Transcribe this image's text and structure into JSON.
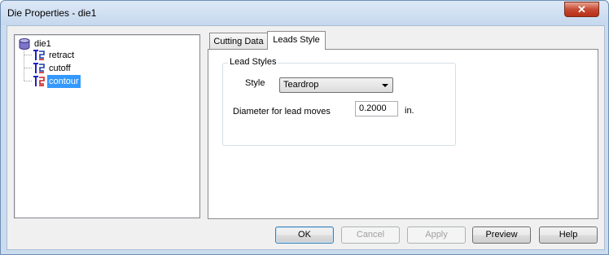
{
  "window": {
    "title": "Die Properties - die1",
    "close_glyph": "✕"
  },
  "tree": {
    "root": {
      "label": "die1",
      "icon": "database-icon"
    },
    "children": [
      {
        "label": "retract",
        "icon": "tool-path-icon",
        "selected": false
      },
      {
        "label": "cutoff",
        "icon": "tool-path-icon",
        "selected": false
      },
      {
        "label": "contour",
        "icon": "tool-path-icon",
        "selected": true
      }
    ]
  },
  "tabs": [
    {
      "label": "Cutting Data",
      "active": false
    },
    {
      "label": "Leads Style",
      "active": true
    }
  ],
  "leads_style": {
    "group_title": "Lead Styles",
    "style_label": "Style",
    "style_value": "Teardrop",
    "diameter_label": "Diameter for lead moves",
    "diameter_value": "0.2000",
    "diameter_unit": "in."
  },
  "buttons": {
    "ok": {
      "label": "OK",
      "enabled": true
    },
    "cancel": {
      "label": "Cancel",
      "enabled": false
    },
    "apply": {
      "label": "Apply",
      "enabled": false
    },
    "preview": {
      "label": "Preview",
      "enabled": true
    },
    "help": {
      "label": "Help",
      "enabled": true
    }
  },
  "colors": {
    "selection": "#3399ff",
    "title_bar": "#cbdcef",
    "close_button": "#c74a34"
  }
}
